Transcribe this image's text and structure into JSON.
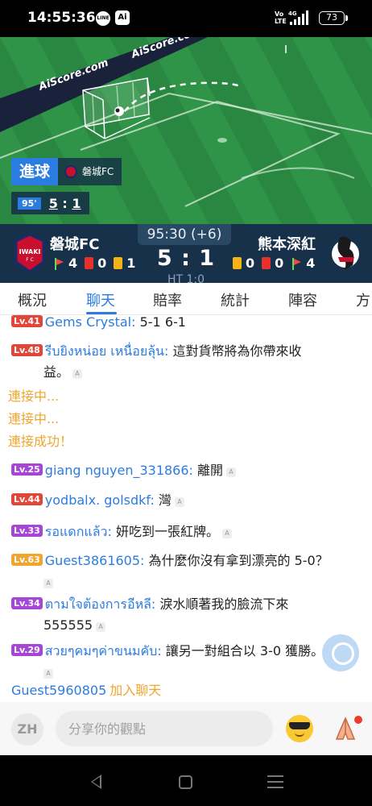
{
  "status_bar": {
    "time": "14:55:36",
    "line_icon": "LINE",
    "ai_icon": "Ai",
    "volte": "Vo LTE",
    "network": "4G",
    "battery": "73"
  },
  "pitch": {
    "watermark": "AiScore.com",
    "goal_label": "進球",
    "goal_team": "磐城FC",
    "minute": "95'",
    "score_home": "5",
    "score_sep": ":",
    "score_away": "1"
  },
  "scorebar": {
    "time": "95:30 (+6)",
    "score": "5 : 1",
    "half_time": "HT 1:0",
    "home": {
      "name": "磐城FC",
      "corners": "4",
      "red_cards": "0",
      "yellow_cards": "1"
    },
    "away": {
      "name": "熊本深紅",
      "yellow_cards": "0",
      "red_cards": "0",
      "corners": "4"
    }
  },
  "tabs": [
    "概況",
    "聊天",
    "賠率",
    "統計",
    "陣容",
    "方"
  ],
  "active_tab": "聊天",
  "chat": {
    "messages": [
      {
        "level": "Lv.41",
        "level_color": "red",
        "user": "Gems Crystal:",
        "text": "5-1 6-1"
      },
      {
        "level": "Lv.48",
        "level_color": "red",
        "user": "รีบยิงหน่อย เหนื่อยลุ้น:",
        "text": "這對貨幣將為你帶來收",
        "text2": "益。"
      },
      {
        "level": "Lv.25",
        "level_color": "purple",
        "user": "giang nguyen_331866:",
        "text": "離開"
      },
      {
        "level": "Lv.44",
        "level_color": "red",
        "user": "yodbalx. golsdkf:",
        "text": "灣"
      },
      {
        "level": "Lv.33",
        "level_color": "purple",
        "user": "รอแดกแล้ว:",
        "text": "妍吃到一張紅牌。"
      },
      {
        "level": "Lv.63",
        "level_color": "orange",
        "user": "Guest3861605:",
        "text": "為什麼你沒有拿到漂亮的 5-0？"
      },
      {
        "level": "Lv.34",
        "level_color": "purple",
        "user": "ตามใจต้องการอีหลี:",
        "text": "淚水順著我的臉流下來",
        "text2": "555555"
      },
      {
        "level": "Lv.29",
        "level_color": "purple",
        "user": "สวยๆคมๆค่าขนมคับ:",
        "text": "讓另一對組合以 3-0 獲勝。"
      }
    ],
    "system": [
      "連接中...",
      "連接中...",
      "連接成功！"
    ],
    "join_name": "Guest5960805",
    "join_text": "加入聊天"
  },
  "input_bar": {
    "lang": "ZH",
    "placeholder": "分享你的觀點"
  },
  "colors": {
    "accent": "#2b7ce0",
    "scorebar_bg": "#17314b",
    "pitch": "#2c8b44",
    "level_red": "#e04738",
    "level_purple": "#a646d6",
    "level_orange": "#f0a52c"
  },
  "icons": [
    "line-app-icon",
    "ai-app-icon",
    "signal-icon",
    "battery-icon",
    "corner-flag-icon",
    "red-card-icon",
    "yellow-card-icon",
    "ai-translate-icon",
    "cool-emoji-icon",
    "pray-icon",
    "back-icon",
    "home-icon",
    "menu-icon"
  ]
}
